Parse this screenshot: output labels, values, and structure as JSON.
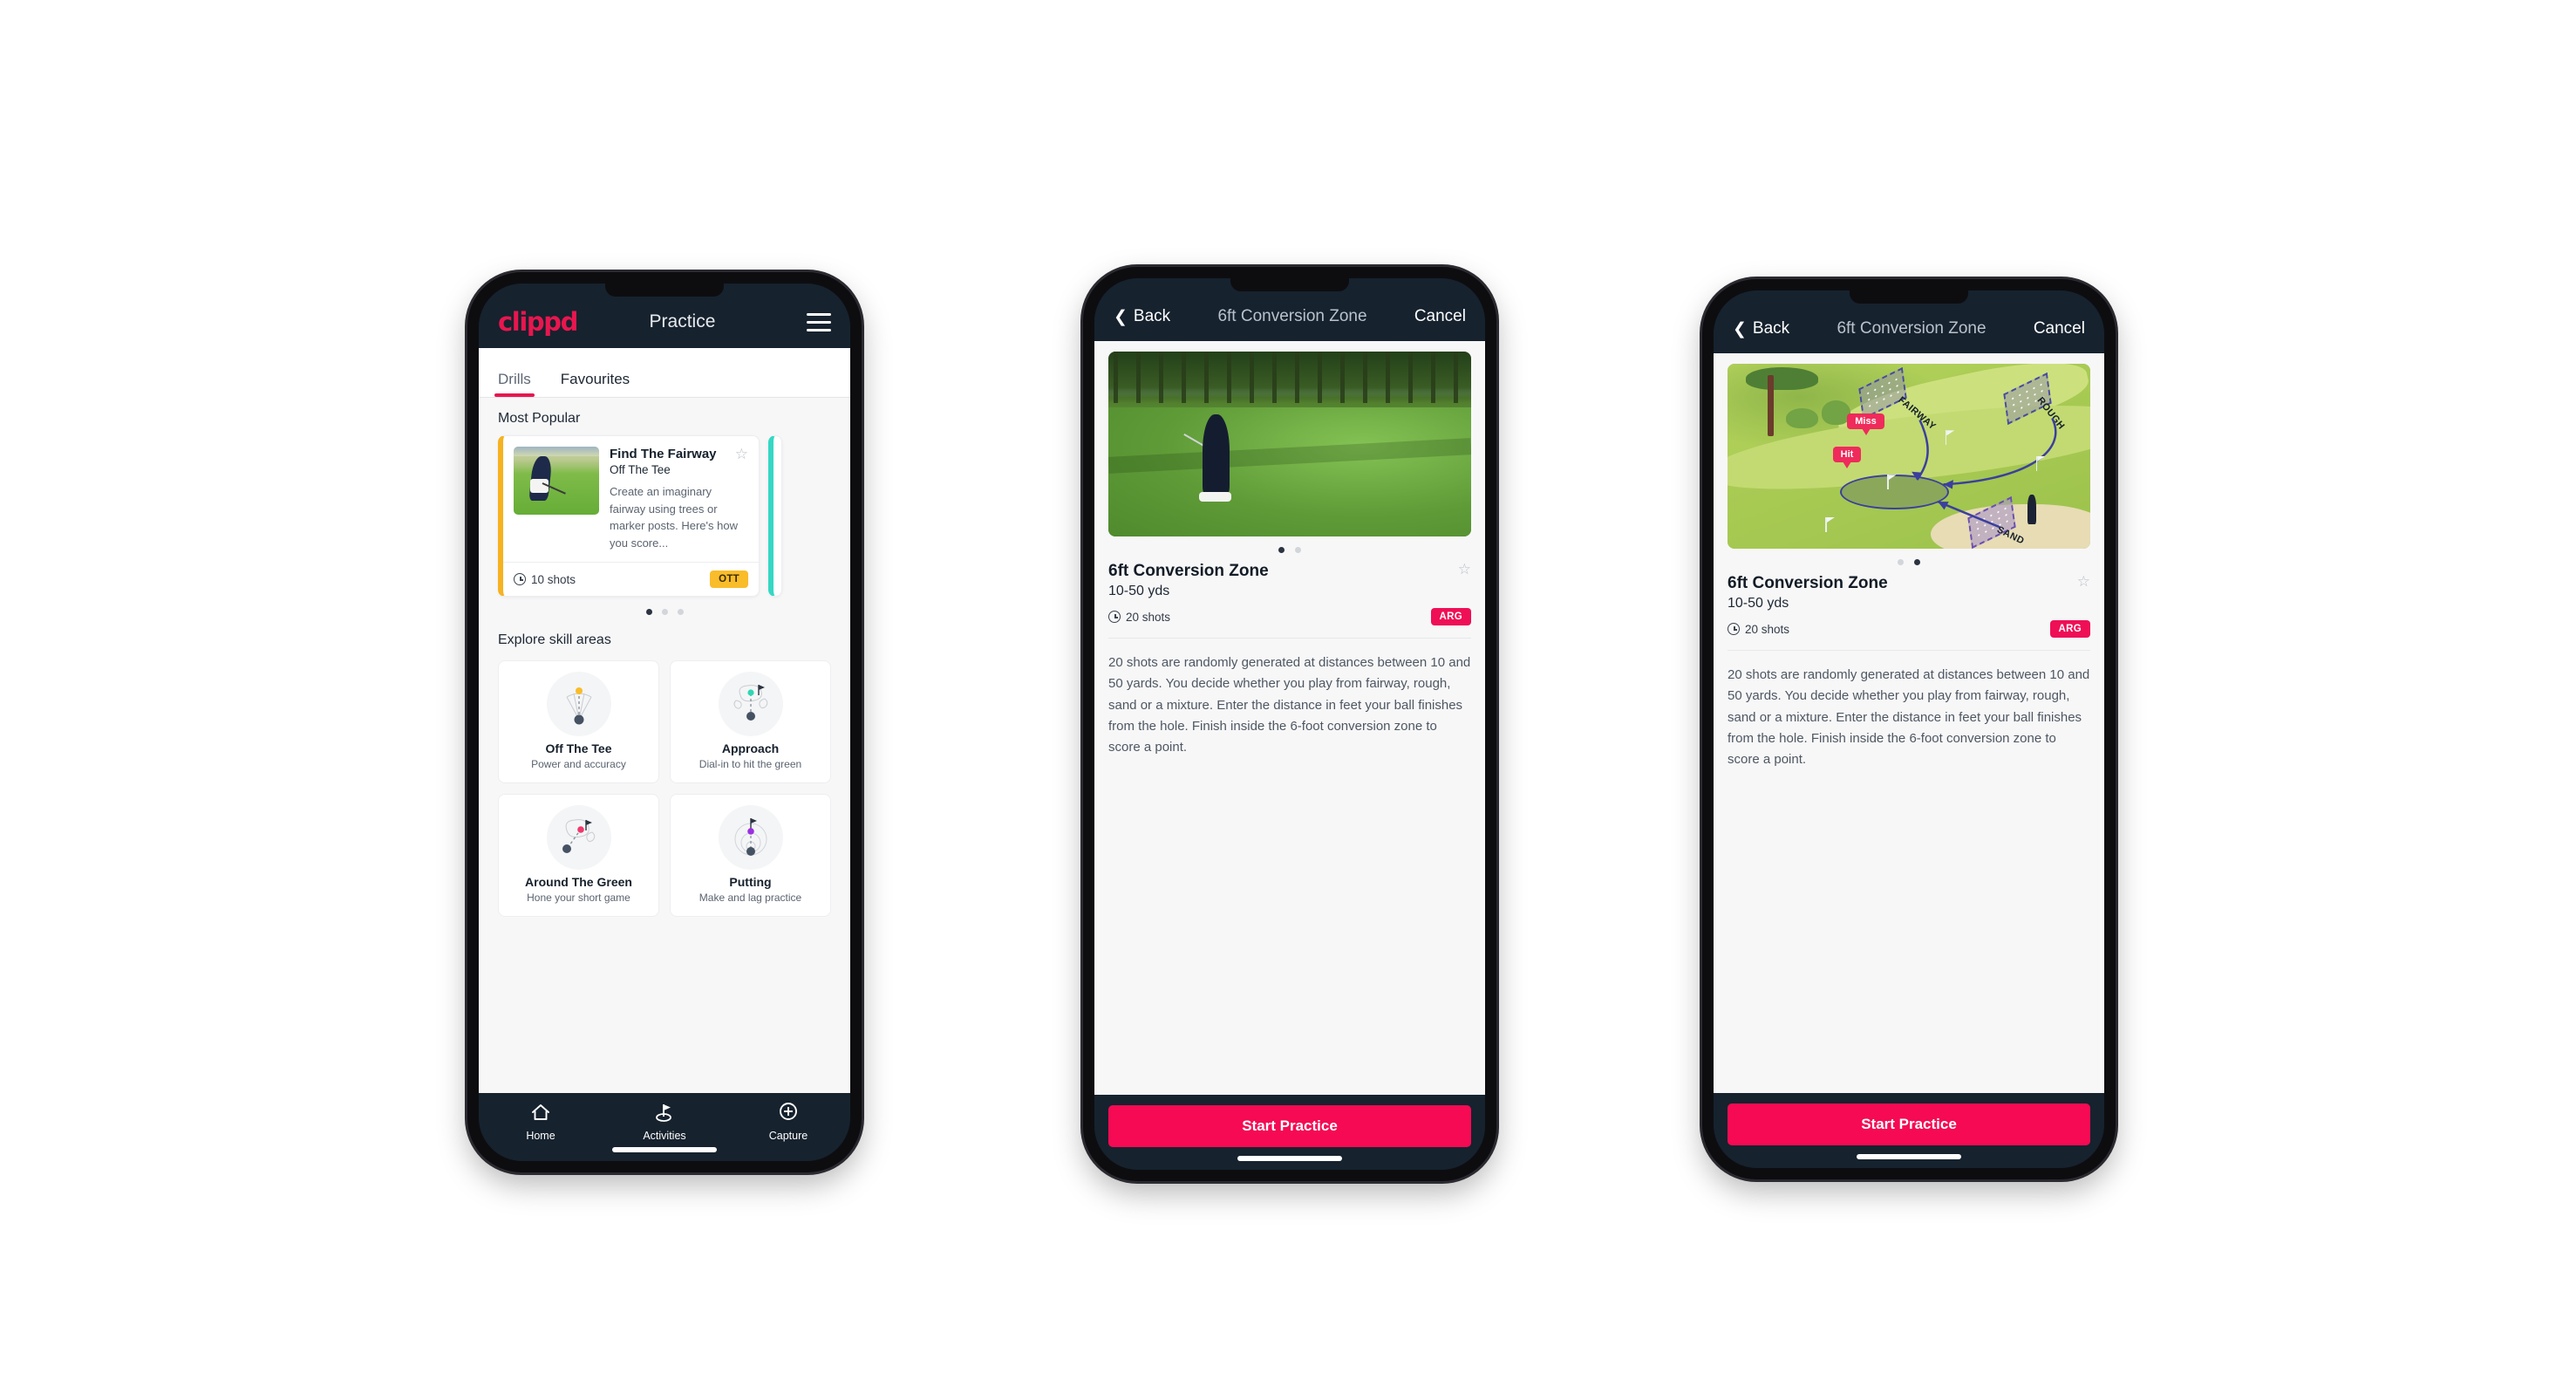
{
  "phone1": {
    "header": {
      "brand": "clippd",
      "title": "Practice",
      "menu_icon": "hamburger-menu-icon"
    },
    "tabs": [
      {
        "label": "Drills",
        "active": true
      },
      {
        "label": "Favourites",
        "active": false
      }
    ],
    "section_most_popular": "Most Popular",
    "drill_card": {
      "name": "Find The Fairway",
      "category": "Off The Tee",
      "description": "Create an imaginary fairway using trees or marker posts. Here's how you score...",
      "shots": "10 shots",
      "badge": "OTT",
      "accent_color": "#f6b221",
      "star_icon": "star-outline-icon"
    },
    "carousel_dots": 3,
    "carousel_active": 0,
    "section_explore": "Explore skill areas",
    "skills": [
      {
        "name": "Off The Tee",
        "sub": "Power and accuracy",
        "icon": "tee-shot-fan-icon",
        "dot_color": "#f9bc2a"
      },
      {
        "name": "Approach",
        "sub": "Dial-in to hit the green",
        "icon": "approach-green-icon",
        "dot_color": "#2fd6b5"
      },
      {
        "name": "Around The Green",
        "sub": "Hone your short game",
        "icon": "chip-green-icon",
        "dot_color": "#f0386b"
      },
      {
        "name": "Putting",
        "sub": "Make and lag practice",
        "icon": "putting-rings-icon",
        "dot_color": "#9b2fe0"
      }
    ],
    "nav": [
      {
        "label": "Home",
        "icon": "home-icon",
        "active": false
      },
      {
        "label": "Activities",
        "icon": "golf-flag-icon",
        "active": true
      },
      {
        "label": "Capture",
        "icon": "plus-circle-icon",
        "active": false
      }
    ]
  },
  "phone2": {
    "header": {
      "back": "Back",
      "title": "6ft Conversion Zone",
      "cancel": "Cancel",
      "back_icon": "chevron-left-icon"
    },
    "media_type": "golf-swing-photo",
    "carousel_dots": 2,
    "carousel_active": 0,
    "drill": {
      "name": "6ft Conversion Zone",
      "distance": "10-50 yds",
      "shots": "20 shots",
      "badge": "ARG",
      "star_icon": "star-outline-icon",
      "description": "20 shots are randomly generated at distances between 10 and 50 yards. You decide whether you play from fairway, rough, sand or a mixture. Enter the distance in feet your ball finishes from the hole. Finish inside the 6-foot conversion zone to score a point."
    },
    "start_button": "Start Practice"
  },
  "phone3": {
    "header": {
      "back": "Back",
      "title": "6ft Conversion Zone",
      "cancel": "Cancel",
      "back_icon": "chevron-left-icon"
    },
    "media_type": "course-map-illustration",
    "map_labels": {
      "fairway": "FAIRWAY",
      "rough": "ROUGH",
      "sand": "SAND",
      "miss": "Miss",
      "hit": "Hit"
    },
    "carousel_dots": 2,
    "carousel_active": 1,
    "drill": {
      "name": "6ft Conversion Zone",
      "distance": "10-50 yds",
      "shots": "20 shots",
      "badge": "ARG",
      "star_icon": "star-outline-icon",
      "description": "20 shots are randomly generated at distances between 10 and 50 yards. You decide whether you play from fairway, rough, sand or a mixture. Enter the distance in feet your ball finishes from the hole. Finish inside the 6-foot conversion zone to score a point."
    },
    "start_button": "Start Practice"
  },
  "colors": {
    "brand_pink": "#e8164f",
    "header_navy": "#16222e",
    "cta_pink": "#f50a53",
    "badge_ott": "#f9bc2a",
    "badge_arg": "#ef0f56",
    "teal_accent": "#34d8c4"
  }
}
